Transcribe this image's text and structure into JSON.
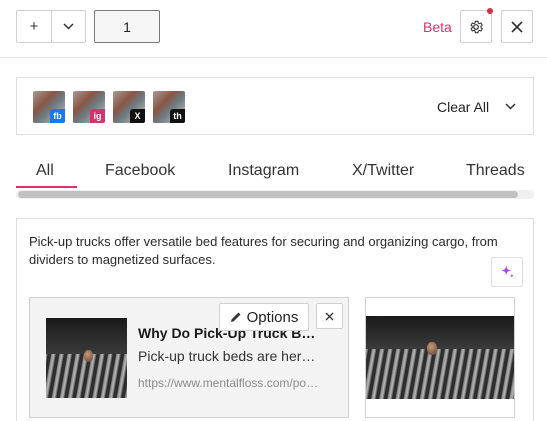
{
  "toolbar": {
    "add_label": "+",
    "page_value": "1",
    "beta_label": "Beta"
  },
  "filter": {
    "sources": [
      {
        "badge": "fb",
        "color": "#1877f2"
      },
      {
        "badge": "ig",
        "color": "#d6336c"
      },
      {
        "badge": "X",
        "color": "#111111"
      },
      {
        "badge": "th",
        "color": "#111111"
      }
    ],
    "clear_label": "Clear All"
  },
  "tabs": [
    {
      "label": "All",
      "active": true
    },
    {
      "label": "Facebook"
    },
    {
      "label": "Instagram"
    },
    {
      "label": "X/Twitter"
    },
    {
      "label": "Threads"
    }
  ],
  "summary": {
    "text": "Pick-up trucks offer versatile bed features for securing and organizing cargo, from dividers to magnetized surfaces."
  },
  "card": {
    "options_label": "Options",
    "title": "Why Do Pick-Up Truck Beds Have Those Grooves?",
    "description": "Pick-up truck beds are here to help",
    "url": "https://www.mentalfloss.com/posts/pick-up-truck-beds"
  },
  "colors": {
    "accent": "#d6336c",
    "notification_dot": "#d42d43",
    "sparkle": "#b640e8"
  }
}
